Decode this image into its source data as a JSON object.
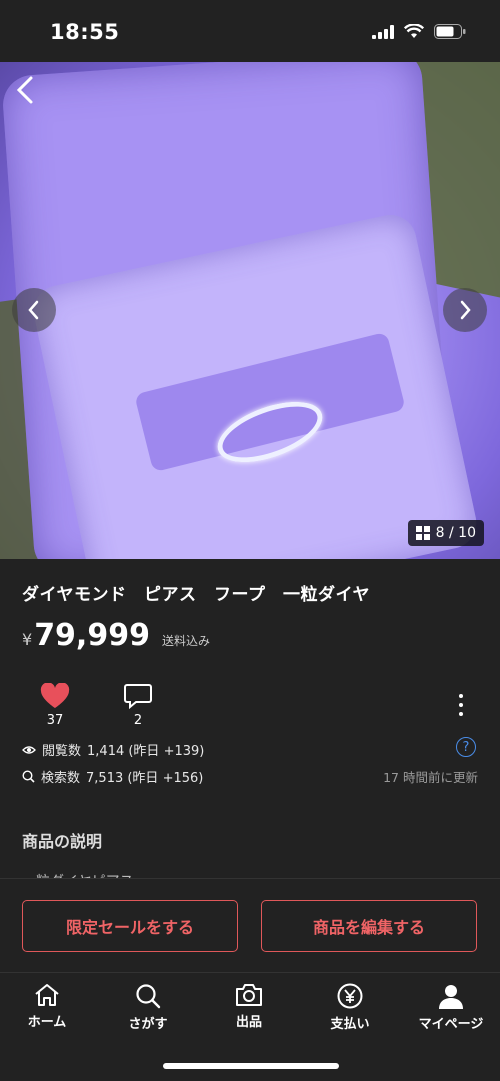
{
  "status_bar": {
    "time": "18:55"
  },
  "gallery": {
    "counter": "8 / 10"
  },
  "product": {
    "title": "ダイヤモンド　ピアス　フープ　一粒ダイヤ",
    "currency": "¥",
    "price": "79,999",
    "shipping_note": "送料込み"
  },
  "engagement": {
    "likes": "37",
    "comments": "2"
  },
  "views": {
    "label": "閲覧数",
    "value": "1,414 (昨日 +139)"
  },
  "searches": {
    "label": "検索数",
    "value": "7,513 (昨日 +156)"
  },
  "updated": "17 時間前に更新",
  "description": {
    "heading": "商品の説明",
    "peek": "一粒ダイヤピアス"
  },
  "actions": {
    "sale_label": "限定セールをする",
    "edit_label": "商品を編集する"
  },
  "tabs": [
    {
      "label": "ホーム",
      "icon": "home-icon"
    },
    {
      "label": "さがす",
      "icon": "search-icon"
    },
    {
      "label": "出品",
      "icon": "camera-icon"
    },
    {
      "label": "支払い",
      "icon": "yen-icon"
    },
    {
      "label": "マイページ",
      "icon": "person-icon"
    }
  ],
  "colors": {
    "accent": "#e0585a",
    "like": "#e8505b",
    "link": "#4a8de8",
    "background": "#222222"
  }
}
